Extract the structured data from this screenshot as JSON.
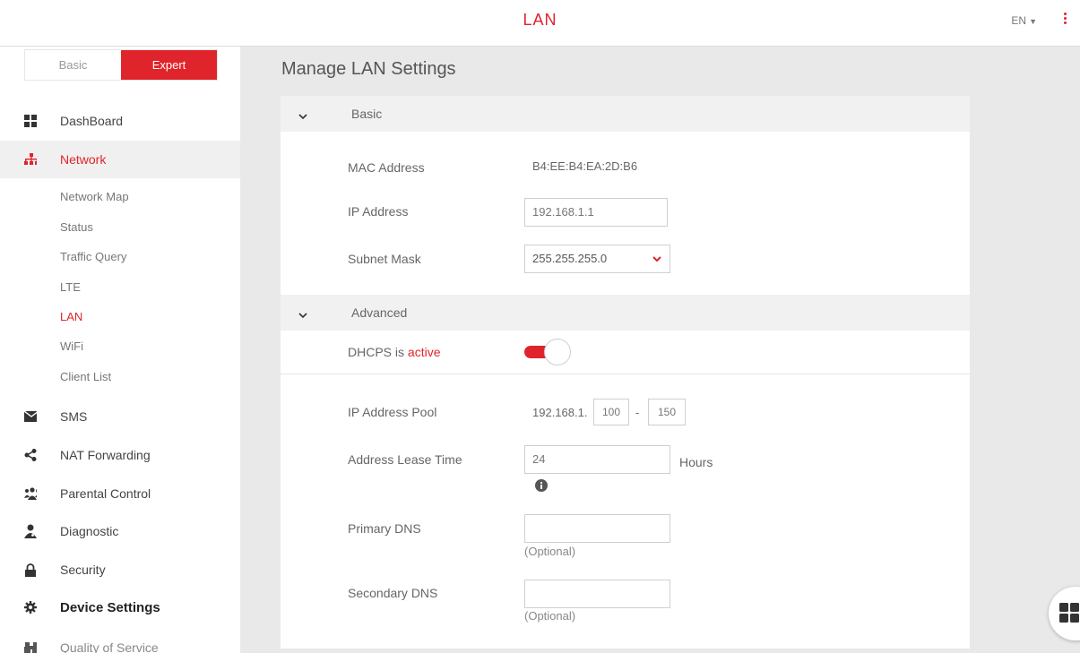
{
  "header": {
    "title": "LAN",
    "language": "EN"
  },
  "mode_toggle": {
    "basic_label": "Basic",
    "expert_label": "Expert",
    "selected": "Expert"
  },
  "sidebar": {
    "items": [
      {
        "label": "DashBoard",
        "icon": "dashboard-icon"
      },
      {
        "label": "Network",
        "icon": "network-icon"
      },
      {
        "label": "SMS",
        "icon": "envelope-icon"
      },
      {
        "label": "NAT Forwarding",
        "icon": "share-icon"
      },
      {
        "label": "Parental Control",
        "icon": "users-icon"
      },
      {
        "label": "Diagnostic",
        "icon": "doctor-icon"
      },
      {
        "label": "Security",
        "icon": "lock-icon"
      },
      {
        "label": "Device Settings",
        "icon": "gear-icon"
      },
      {
        "label": "Quality of Service",
        "icon": "binoculars-icon"
      }
    ],
    "network_sub": [
      "Network Map",
      "Status",
      "Traffic Query",
      "LTE",
      "LAN",
      "WiFi",
      "Client List"
    ]
  },
  "main": {
    "page_title": "Manage LAN Settings",
    "basic": {
      "header": "Basic",
      "mac_label": "MAC Address",
      "mac_value": "B4:EE:B4:EA:2D:B6",
      "ip_label": "IP Address",
      "ip_value": "192.168.1.1",
      "subnet_label": "Subnet Mask",
      "subnet_value": "255.255.255.0"
    },
    "advanced": {
      "header": "Advanced",
      "dhcps_label": "DHCPS is",
      "dhcps_status": "active",
      "dhcps_on": true,
      "pool_label": "IP Address Pool",
      "pool_prefix": "192.168.1.",
      "pool_start": "100",
      "pool_sep": "-",
      "pool_end": "150",
      "lease_label": "Address Lease Time",
      "lease_value": "24",
      "lease_unit": "Hours",
      "primary_dns_label": "Primary DNS",
      "primary_dns_value": "",
      "primary_dns_note": "(Optional)",
      "secondary_dns_label": "Secondary DNS",
      "secondary_dns_value": "",
      "secondary_dns_note": "(Optional)"
    }
  },
  "colors": {
    "accent": "#e0242b",
    "background": "#e9e9e9",
    "panel": "#ffffff"
  }
}
